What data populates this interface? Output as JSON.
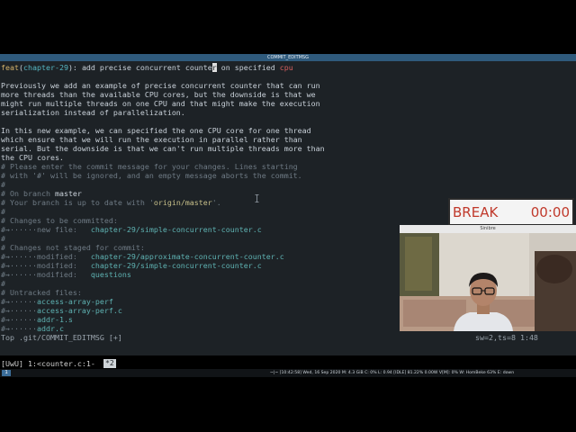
{
  "window": {
    "title": "COMMIT_EDITMSG"
  },
  "editor": {
    "subject": {
      "type": "feat",
      "scope": "chapter-29",
      "text_before_cursor": "add precise concurrent counte",
      "cursor_char": "r",
      "text_after_cursor": " on specified ",
      "cpu_word": "cpu"
    },
    "body": [
      "Previously we add an example of precise concurrent counter that can run",
      "more threads than the available CPU cores, but the downside is that we",
      "might run multiple threads on one CPU and that might make the execution",
      "serialization instead of parallelization.",
      "In this new example, we can specified the one CPU core for one thread",
      "which ensure that we will run the execution in parallel rather than",
      "serial. But the downside is that we can't run multiple threads more than",
      "the CPU cores."
    ],
    "comments": {
      "l1": "# Please enter the commit message for your changes. Lines starting",
      "l2": "# with '#' will be ignored, and an empty message aborts the commit.",
      "hash": "#",
      "branch_prefix": "# On branch ",
      "branch": "master",
      "uptodate_prefix": "# Your branch is up to date with '",
      "remote": "origin/master",
      "uptodate_suffix": "'.",
      "staged_header": "# Changes to be committed:",
      "staged_status": "#→······new file:   ",
      "staged_file": "chapter-29/simple-concurrent-counter.c",
      "unstaged_header": "# Changes not staged for commit:",
      "mod_status": "#→······modified:   ",
      "unstaged_files": [
        "chapter-29/approximate-concurrent-counter.c",
        "chapter-29/simple-concurrent-counter.c",
        "questions"
      ],
      "untracked_header": "# Untracked files:",
      "untracked_prefix": "#→······",
      "untracked_files": [
        "access-array-perf",
        "access-array-perf.c",
        "addr-1.s",
        "addr.c"
      ]
    },
    "status_left": "Top .git/COMMIT_EDITMSG [+]",
    "status_right": "sw=2,ts=8 1:48"
  },
  "tmux": {
    "session": "[UwU] 1:<counter.c:1-",
    "window_tag": "*2"
  },
  "sysbar": {
    "workspace": "1",
    "items": "~|~   [10:42:58] Wed, 16 Sep 2020   M: 4.3 GiB   C: 0%   L: 0.94   [IDLE] 81.22% 0.00W   V[M]: 0%   W: HomBeke 63%   E: down"
  },
  "break_timer": {
    "label": "BREAK",
    "time": "00:00"
  },
  "webcam": {
    "title": "Sinibre"
  },
  "colors": {
    "terminal_bg": "#1d2226",
    "title_bar": "#2f5a7c",
    "comment": "#6f7b85",
    "file": "#5fb3b3",
    "break_text": "#c0392b"
  }
}
